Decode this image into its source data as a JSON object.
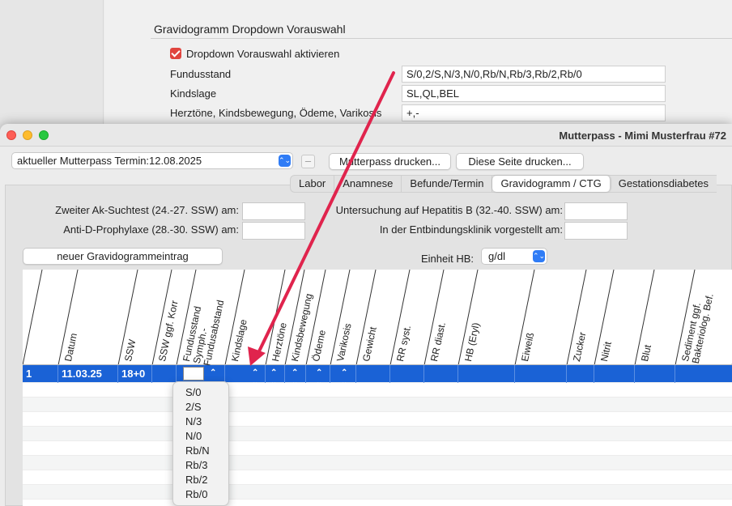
{
  "settings": {
    "section_title": "Gravidogramm Dropdown Vorauswahl",
    "checkbox_label": "Dropdown Vorauswahl aktivieren",
    "rows": [
      {
        "label": "Fundusstand",
        "value": "S/0,2/S,N/3,N/0,Rb/N,Rb/3,Rb/2,Rb/0"
      },
      {
        "label": "Kindslage",
        "value": "SL,QL,BEL"
      },
      {
        "label": "Herztöne, Kindsbewegung, Ödeme, Varikosis",
        "value": "+,-"
      }
    ]
  },
  "window": {
    "title": "Mutterpass -  Mimi Musterfrau #72",
    "termin_select": "aktueller Mutterpass Termin:12.08.2025",
    "minus_label": "–",
    "print_mutterpass": "Mutterpass drucken...",
    "print_page": "Diese Seite drucken...",
    "tabs": [
      "Labor",
      "Anamnese",
      "Befunde/Termin",
      "Gravidogramm / CTG",
      "Gestationsdiabetes"
    ],
    "active_tab": "Gravidogramm / CTG"
  },
  "form": {
    "suchtest_label": "Zweiter Ak-Suchtest (24.-27. SSW) am:",
    "prophylaxe_label": "Anti-D-Prophylaxe (28.-30. SSW) am:",
    "hepatitis_label": "Untersuchung auf Hepatitis B (32.-40. SSW) am:",
    "klinik_label": "In der Entbindungsklinik vorgestellt am:",
    "new_entry_button": "neuer Gravidogrammeintrag",
    "unit_label": "Einheit HB:",
    "unit_value": "g/dl"
  },
  "grid": {
    "columns": [
      "Datum",
      "SSW",
      "SSW ggf. Korr",
      "Fundusstand Symph.-Fundusabstand",
      "Kindslage",
      "Herztöne",
      "Kindsbewegung",
      "Ödeme",
      "Varikosis",
      "Gewicht",
      "RR syst.",
      "RR diast.",
      "HB (Eryl)",
      "Eiweiß",
      "Zucker",
      "Nitrit",
      "Blut",
      "Sediment ggf. Bakteriolog. Bef."
    ],
    "selected_row": {
      "index": "1",
      "datum": "11.03.25",
      "ssw": "18+0"
    }
  },
  "dropdown": {
    "items": [
      "S/0",
      "2/S",
      "N/3",
      "N/0",
      "Rb/N",
      "Rb/3",
      "Rb/2",
      "Rb/0"
    ]
  },
  "colors": {
    "selection": "#1a62d6",
    "arrow": "#e0244d",
    "checkbox": "#e0443e"
  }
}
